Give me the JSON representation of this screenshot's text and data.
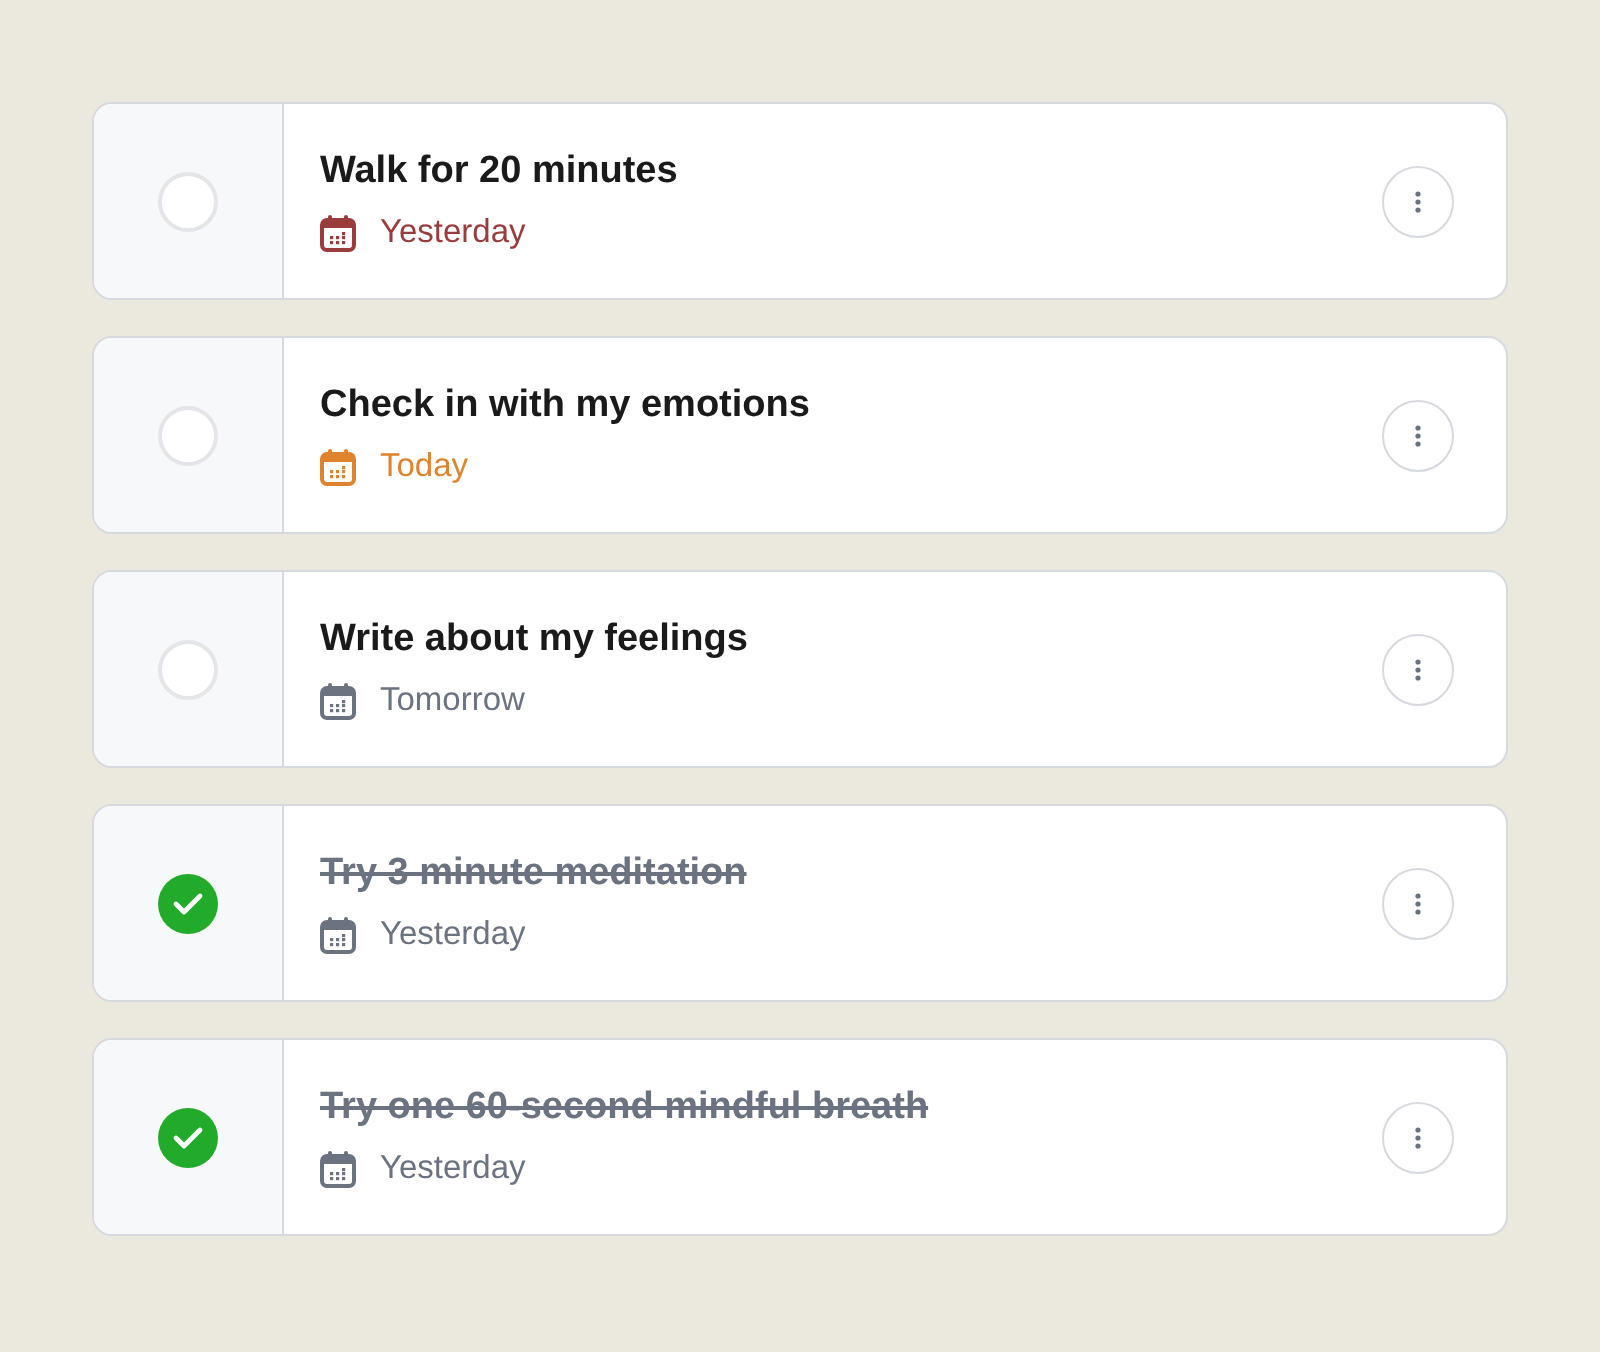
{
  "tasks": [
    {
      "title": "Walk for 20 minutes",
      "checked": false,
      "due": "Yesterday",
      "color": "#9b3c3c"
    },
    {
      "title": "Check in with my emotions",
      "checked": false,
      "due": "Today",
      "color": "#e0832f"
    },
    {
      "title": "Write about my feelings",
      "checked": false,
      "due": "Tomorrow",
      "color": "#6b7280"
    },
    {
      "title": "Try 3 minute meditation",
      "checked": true,
      "due": "Yesterday",
      "color": "#6b7280"
    },
    {
      "title": "Try one 60-second mindful breath",
      "checked": true,
      "due": "Yesterday",
      "color": "#6b7280"
    }
  ]
}
